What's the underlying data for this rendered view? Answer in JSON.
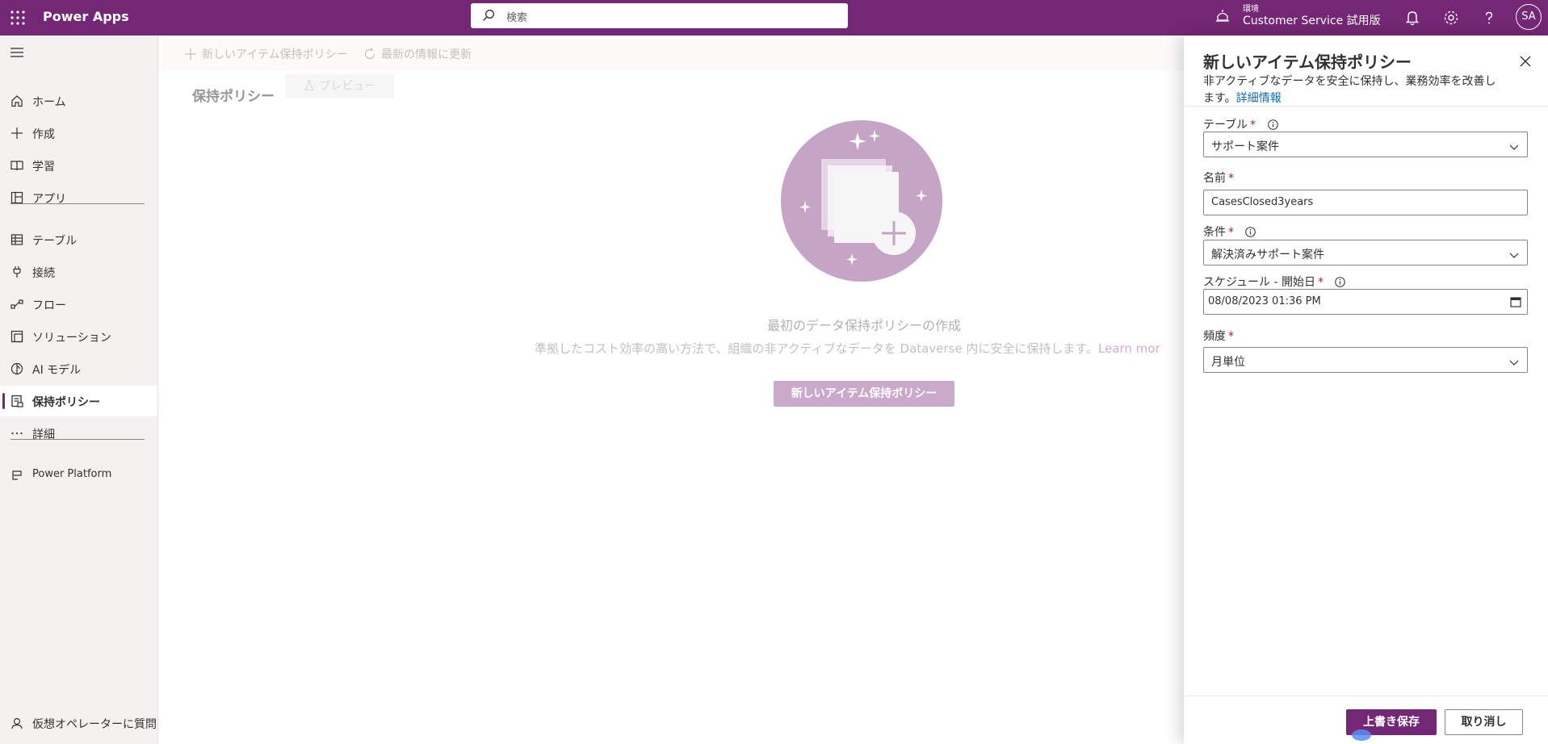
{
  "topbar": {
    "app_name": "Power Apps",
    "search_placeholder": "検索",
    "env_label": "環境",
    "env_name": "Customer Service 試用版",
    "avatar": "SA",
    "bg_color": "#742774"
  },
  "nav": {
    "items": [
      {
        "label": "ホーム",
        "icon": "home-icon"
      },
      {
        "label": "作成",
        "icon": "plus-icon"
      },
      {
        "label": "学習",
        "icon": "book-icon"
      },
      {
        "label": "アプリ",
        "icon": "apps-icon"
      },
      {
        "label": "テーブル",
        "icon": "table-icon"
      },
      {
        "label": "接続",
        "icon": "plug-icon"
      },
      {
        "label": "フロー",
        "icon": "flow-icon"
      },
      {
        "label": "ソリューション",
        "icon": "solution-icon"
      },
      {
        "label": "AI モデル",
        "icon": "brain-icon"
      },
      {
        "label": "保持ポリシー",
        "icon": "retention-icon",
        "active": true
      },
      {
        "label": "詳細",
        "icon": "more-icon"
      },
      {
        "label": "Power Platform",
        "icon": "power-platform-icon"
      }
    ],
    "bottom_label": "仮想オペレーターに質問"
  },
  "commandbar": {
    "new_policy": "新しいアイテム保持ポリシー",
    "refresh": "最新の情報に更新"
  },
  "main": {
    "title": "保持ポリシー",
    "preview": "プレビュー",
    "empty_title": "最初のデータ保持ポリシーの作成",
    "empty_desc": "準拠したコスト効率の高い方法で、組織の非アクティブなデータを Dataverse 内に安全に保持します。",
    "learn_more": "Learn mor",
    "empty_button": "新しいアイテム保持ポリシー"
  },
  "panel": {
    "title": "新しいアイテム保持ポリシー",
    "description": "非アクティブなデータを安全に保持し、業務効率を改善します。",
    "details_link": "詳細情報",
    "fields": {
      "table": {
        "label": "テーブル",
        "value": "サポート案件"
      },
      "name": {
        "label": "名前",
        "value": "CasesClosed3years"
      },
      "condition": {
        "label": "条件",
        "value": "解決済みサポート案件"
      },
      "schedule": {
        "label": "スケジュール - 開始日",
        "value": "08/08/2023 01:36 PM"
      },
      "frequency": {
        "label": "頻度",
        "value": "月単位"
      }
    },
    "required_mark": "*",
    "save_label": "上書き保存",
    "cancel_label": "取り消し"
  }
}
